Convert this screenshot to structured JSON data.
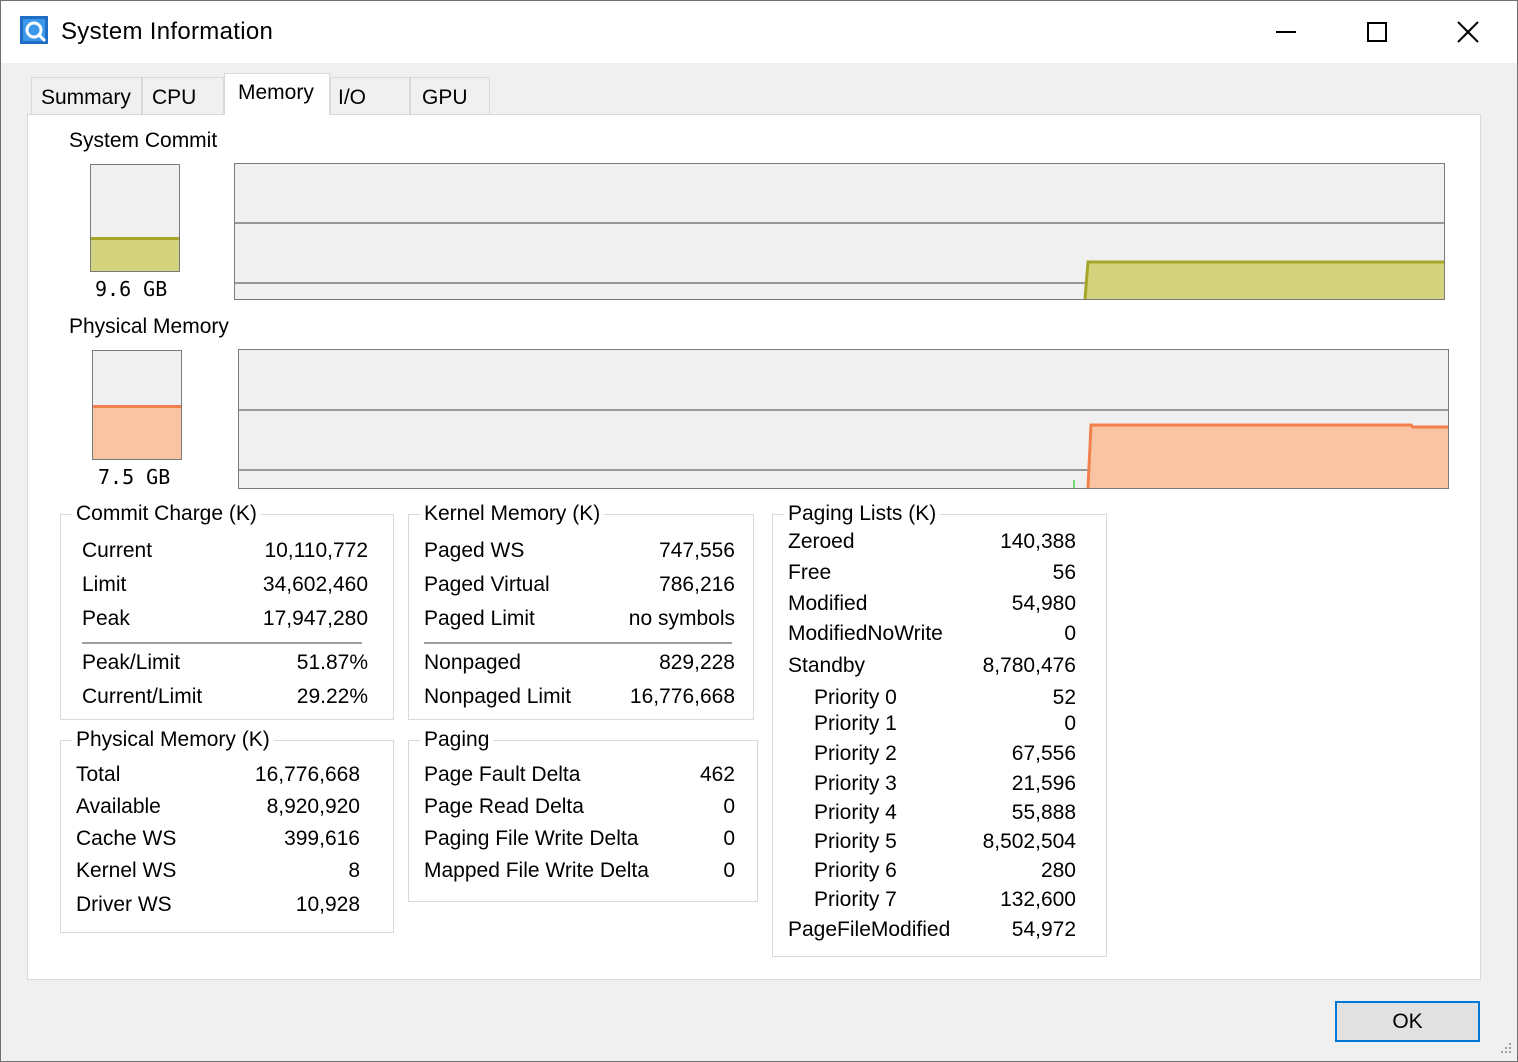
{
  "window": {
    "title": "System Information"
  },
  "tabs": [
    {
      "label": "Summary"
    },
    {
      "label": "CPU"
    },
    {
      "label": "Memory"
    },
    {
      "label": "I/O"
    },
    {
      "label": "GPU"
    }
  ],
  "active_tab": "Memory",
  "system_commit": {
    "label": "System Commit",
    "meter_value": "9.6 GB",
    "fraction": 0.29,
    "color": "#d4d47e",
    "line_color": "#a5a52a"
  },
  "physical_memory_graph": {
    "label": "Physical Memory",
    "meter_value": "7.5 GB",
    "fraction": 0.47,
    "color": "#f8c4a4",
    "line_color": "#f2804c"
  },
  "commit_charge": {
    "title": "Commit Charge (K)",
    "rows": [
      {
        "label": "Current",
        "value": "10,110,772"
      },
      {
        "label": "Limit",
        "value": "34,602,460"
      },
      {
        "label": "Peak",
        "value": "17,947,280"
      },
      {
        "label": "Peak/Limit",
        "value": "51.87%"
      },
      {
        "label": "Current/Limit",
        "value": "29.22%"
      }
    ]
  },
  "kernel_memory": {
    "title": "Kernel Memory (K)",
    "rows": [
      {
        "label": "Paged WS",
        "value": "747,556"
      },
      {
        "label": "Paged Virtual",
        "value": "786,216"
      },
      {
        "label": "Paged Limit",
        "value": "no symbols"
      },
      {
        "label": "Nonpaged",
        "value": "829,228"
      },
      {
        "label": "Nonpaged Limit",
        "value": "16,776,668"
      }
    ]
  },
  "paging_lists": {
    "title": "Paging Lists (K)",
    "rows": [
      {
        "label": "Zeroed",
        "value": "140,388"
      },
      {
        "label": "Free",
        "value": "56"
      },
      {
        "label": "Modified",
        "value": "54,980"
      },
      {
        "label": "ModifiedNoWrite",
        "value": "0"
      },
      {
        "label": "Standby",
        "value": "8,780,476"
      },
      {
        "label": "Priority 0",
        "value": "52"
      },
      {
        "label": "Priority 1",
        "value": "0"
      },
      {
        "label": "Priority 2",
        "value": "67,556"
      },
      {
        "label": "Priority 3",
        "value": "21,596"
      },
      {
        "label": "Priority 4",
        "value": "55,888"
      },
      {
        "label": "Priority 5",
        "value": "8,502,504"
      },
      {
        "label": "Priority 6",
        "value": "280"
      },
      {
        "label": "Priority 7",
        "value": "132,600"
      },
      {
        "label": "PageFileModified",
        "value": "54,972"
      }
    ]
  },
  "physical_memory": {
    "title": "Physical Memory (K)",
    "rows": [
      {
        "label": "Total",
        "value": "16,776,668"
      },
      {
        "label": "Available",
        "value": "8,920,920"
      },
      {
        "label": "Cache WS",
        "value": "399,616"
      },
      {
        "label": "Kernel WS",
        "value": "8"
      },
      {
        "label": "Driver WS",
        "value": "10,928"
      }
    ]
  },
  "paging": {
    "title": "Paging",
    "rows": [
      {
        "label": "Page Fault Delta",
        "value": "462"
      },
      {
        "label": "Page Read Delta",
        "value": "0"
      },
      {
        "label": "Paging File Write Delta",
        "value": "0"
      },
      {
        "label": "Mapped File Write Delta",
        "value": "0"
      }
    ]
  },
  "buttons": {
    "ok": "OK"
  }
}
